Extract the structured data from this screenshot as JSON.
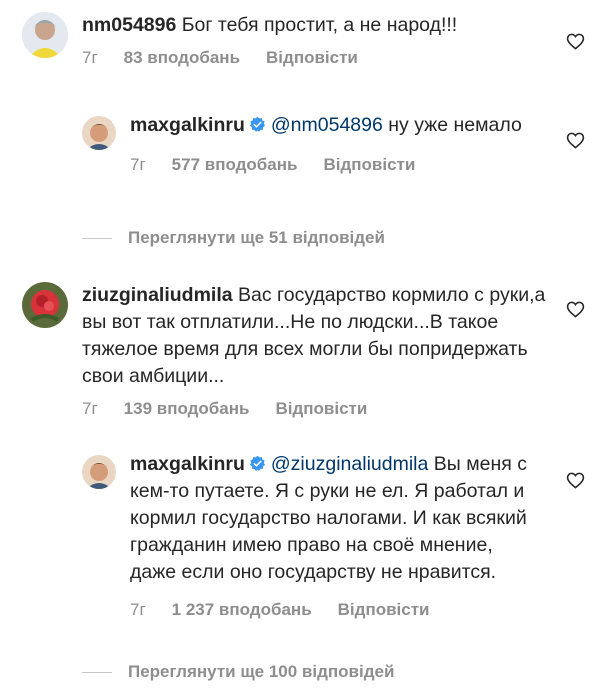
{
  "comments": [
    {
      "username": "nm054896",
      "text": "Бог тебя простит, а не народ!!!",
      "time": "7г",
      "likes": "83 вподобань",
      "reply": "Відповісти"
    },
    {
      "username": "maxgalkinru",
      "mention": "@nm054896",
      "text": " ну уже немало",
      "time": "7г",
      "likes": "577 вподобань",
      "reply": "Відповісти"
    },
    {
      "username": "ziuzginaliudmila",
      "text": "Вас государство кормило с руки,а вы вот так отплатили...Не по людски...В такое тяжелое время для всех могли бы попридержать свои амбиции...",
      "time": "7г",
      "likes": "139 вподобань",
      "reply": "Відповісти"
    },
    {
      "username": "maxgalkinru",
      "mention": "@ziuzginaliudmila",
      "text": " Вы меня с кем-то путаете. Я с руки не ел. Я работал и кормил государство налогами. И как всякий гражданин имею право на своё мнение, даже если оно государству не нравится.",
      "time": "7г",
      "likes": "1 237 вподобань",
      "reply": "Відповісти"
    }
  ],
  "view_replies": [
    "Переглянути ще 51 відповідей",
    "Переглянути ще 100 відповідей"
  ],
  "colors": {
    "text": "#262626",
    "secondary": "#8e8e8e",
    "mention": "#00376b",
    "verified": "#3897f0"
  }
}
